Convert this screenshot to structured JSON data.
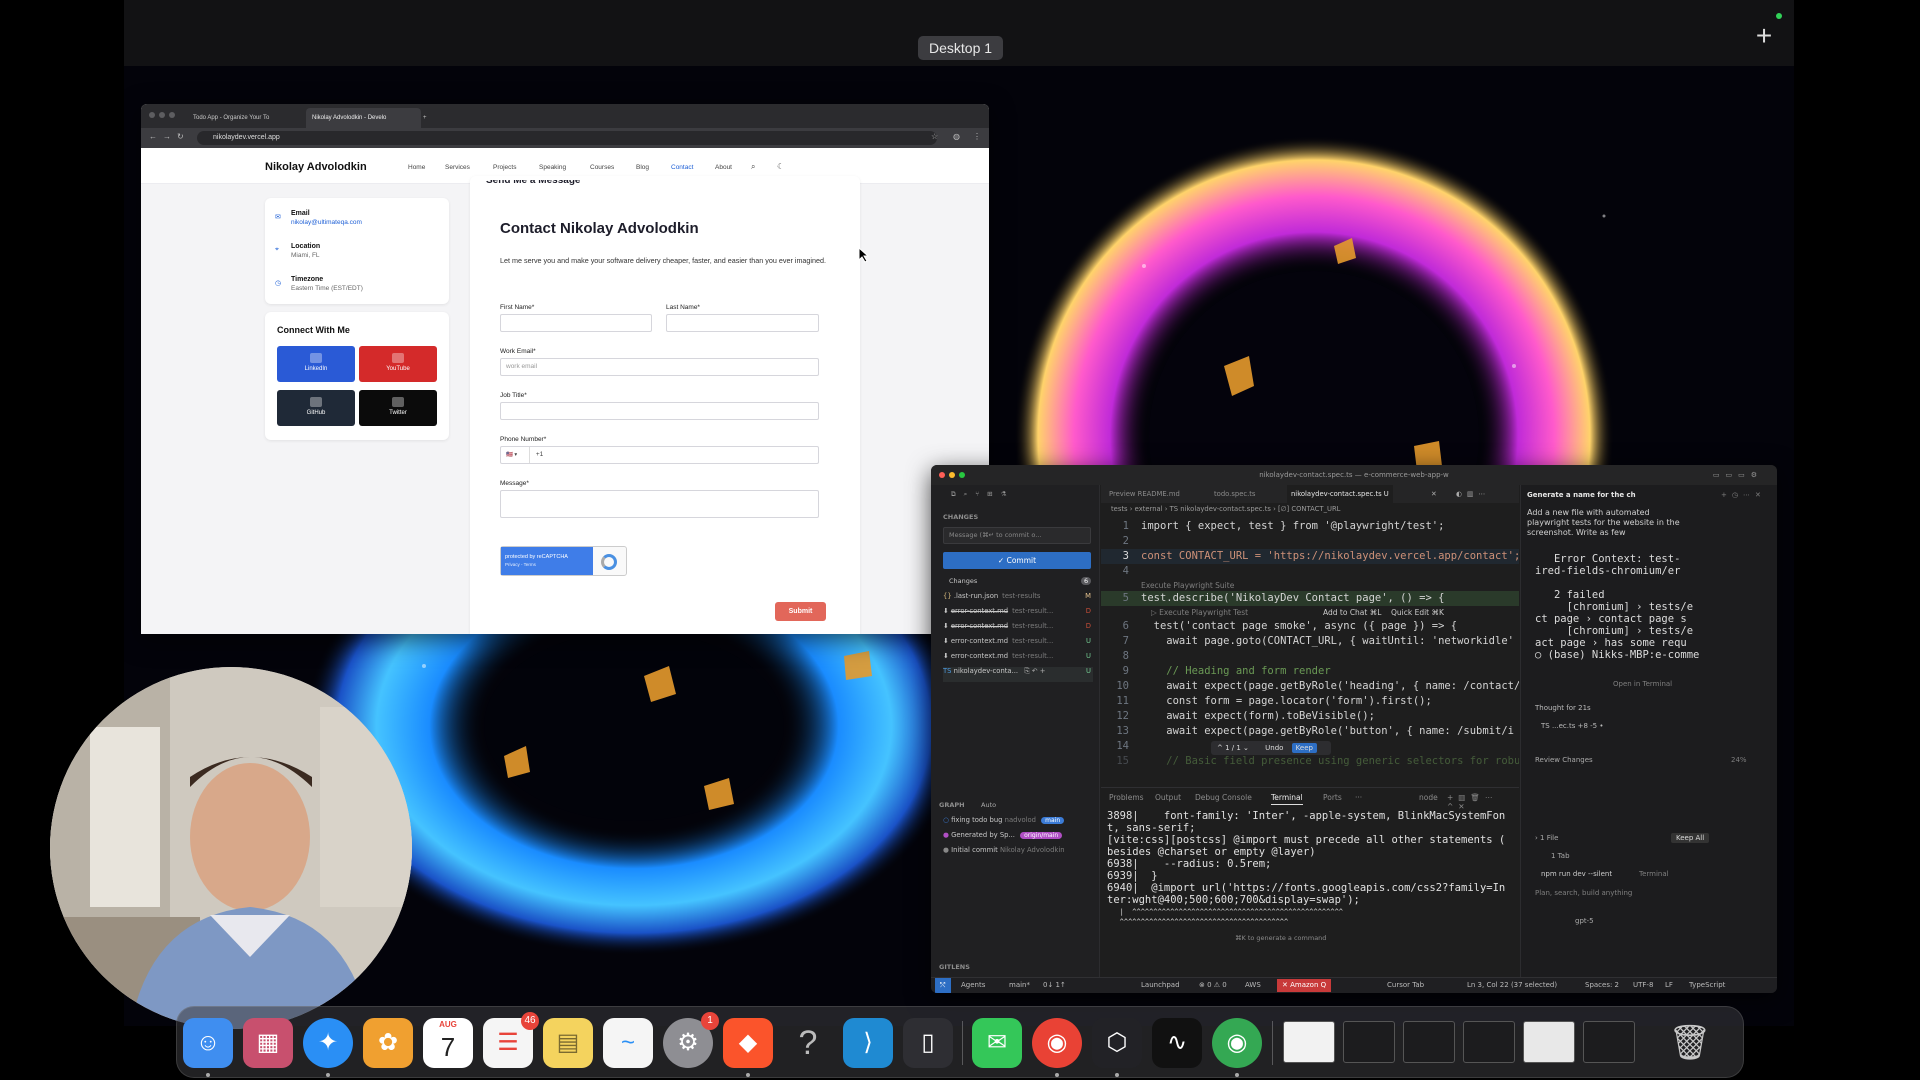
{
  "desktop": {
    "space_label": "Desktop 1",
    "add_space": "+"
  },
  "browser": {
    "tabs": [
      {
        "label": "Todo App - Organize Your To"
      },
      {
        "label": "Nikolay Advolodkin - Develo"
      }
    ],
    "new_tab": "+",
    "url": "nikolaydev.vercel.app",
    "site": {
      "brand": "Nikolay Advolodkin",
      "nav": [
        "Home",
        "Services",
        "Projects",
        "Speaking",
        "Courses",
        "Blog",
        "Contact",
        "About"
      ],
      "active_nav": "Contact",
      "partial_heading": "Send Me a Message",
      "info": [
        {
          "label": "Email",
          "value": "nikolay@ultimateqa.com"
        },
        {
          "label": "Location",
          "value": "Miami, FL"
        },
        {
          "label": "Timezone",
          "value": "Eastern Time (EST/EDT)"
        }
      ],
      "connect_title": "Connect With Me",
      "social": [
        {
          "label": "LinkedIn",
          "color": "#2a5ad6"
        },
        {
          "label": "YouTube",
          "color": "#d42a2a"
        },
        {
          "label": "GitHub",
          "color": "#1f2937"
        },
        {
          "label": "Twitter",
          "color": "#0b0b0b"
        }
      ],
      "form": {
        "title": "Contact Nikolay Advolodkin",
        "description": "Let me serve you and make your software delivery cheaper, faster, and easier than you ever imagined.",
        "first_name_label": "First Name*",
        "last_name_label": "Last Name*",
        "work_email_label": "Work Email*",
        "work_email_placeholder": "work email",
        "job_title_label": "Job Title*",
        "phone_label": "Phone Number*",
        "phone_country": "🇺🇸 ▾",
        "phone_prefix": "+1",
        "message_label": "Message*",
        "recaptcha_text": "protected by reCAPTCHA",
        "recaptcha_sub": "Privacy - Terms",
        "submit_label": "Submit"
      }
    }
  },
  "vscode": {
    "title": "nikolaydev-contact.spec.ts — e-commerce-web-app-w",
    "source_control": {
      "section": "CHANGES",
      "commit_placeholder": "Message (⌘↵ to commit o...",
      "commit_label": "✓ Commit",
      "changes_label": "Changes",
      "changes_count": "6",
      "files": [
        {
          "name": ".last-run.json",
          "path": "test-results",
          "status": "M",
          "strike": false
        },
        {
          "name": "error-context.md",
          "path": "test-result...",
          "status": "D",
          "strike": true
        },
        {
          "name": "error-context.md",
          "path": "test-result...",
          "status": "D",
          "strike": true
        },
        {
          "name": "error-context.md",
          "path": "test-result...",
          "status": "U",
          "strike": false
        },
        {
          "name": "error-context.md",
          "path": "test-result...",
          "status": "U",
          "strike": false
        },
        {
          "name": "nikolaydev-conta...",
          "path": "",
          "status": "U",
          "strike": false
        }
      ],
      "graph_label": "GRAPH",
      "graph_mode": "Auto",
      "commits": [
        {
          "message": "fixing todo bug",
          "author": "nadvolod",
          "badge": "main",
          "badge_color": "#3b7bd6"
        },
        {
          "message": "Generated by Sp...",
          "author": "",
          "badge": "origin/main",
          "badge_color": "#b04fc4"
        },
        {
          "message": "Initial commit",
          "author": "Nikolay Advolodkin",
          "badge": "",
          "badge_color": ""
        }
      ],
      "gitlens": "GITLENS"
    },
    "tabs": [
      "Preview README.md",
      "todo.spec.ts",
      "nikolaydev-contact.spec.ts U"
    ],
    "breadcrumb": "tests › external › TS nikolaydev-contact.spec.ts › [∅] CONTACT_URL",
    "code": [
      {
        "n": "1",
        "text": "import { expect, test } from '@playwright/test';"
      },
      {
        "n": "2",
        "text": ""
      },
      {
        "n": "3",
        "text": "const CONTACT_URL = 'https://nikolaydev.vercel.app/contact';"
      },
      {
        "n": "4",
        "text": ""
      },
      {
        "n": "5",
        "text": "test.describe('NikolayDev Contact page', () => {"
      },
      {
        "n": "6",
        "text": "  test('contact page smoke', async ({ page }) => {"
      },
      {
        "n": "7",
        "text": "    await page.goto(CONTACT_URL, { waitUntil: 'networkidle' }"
      },
      {
        "n": "8",
        "text": ""
      },
      {
        "n": "9",
        "text": "    // Heading and form render"
      },
      {
        "n": "10",
        "text": "    await expect(page.getByRole('heading', { name: /contact/i"
      },
      {
        "n": "11",
        "text": "    const form = page.locator('form').first();"
      },
      {
        "n": "12",
        "text": "    await expect(form).toBeVisible();"
      },
      {
        "n": "13",
        "text": "    await expect(page.getByRole('button', { name: /submit/i })"
      },
      {
        "n": "14",
        "text": ""
      },
      {
        "n": "15",
        "text": "    // Basic field presence using generic selectors for robust"
      }
    ],
    "codelens_suite": "Execute Playwright Suite",
    "codelens_test": "▷ Execute Playwright Test",
    "hint_chat": "Add to Chat ⌘L",
    "hint_edit": "Quick Edit ⌘K",
    "inline_counter": "^ 1 / 1 ⌄",
    "undo_label": "Undo",
    "keep_label": "Keep",
    "panel_tabs": [
      "Problems",
      "Output",
      "Debug Console",
      "Terminal",
      "Ports",
      "···"
    ],
    "terminal_shell": "node",
    "terminal": [
      "3898|    font-family: 'Inter', -apple-system, BlinkMacSystemFon",
      "t, sans-serif;",
      "[vite:css][postcss] @import must precede all other statements (",
      "besides @charset or empty @layer)",
      "6938|    --radius: 0.5rem;",
      "6939|  }",
      "6940|  @import url('https://fonts.googleapis.com/css2?family=In",
      "ter:wght@400;500;600;700&display=swap');",
      "   |  ^^^^^^^^^^^^^^^^^^^^^^^^^^^^^^^^^^^^^^^^^^^^^^^^^^",
      "   ^^^^^^^^^^^^^^^^^^^^^^^^^^^^^^^^^^^^^^^^"
    ],
    "terminal_hint": "⌘K to generate a command",
    "chat": {
      "title": "Generate a name for the ch",
      "prompt": "Add a new file with automated playwright tests for the website in the screenshot. Write as few",
      "error_lines": [
        "   Error Context: test-",
        "ired-fields-chromium/er",
        "",
        "   2 failed",
        "     [chromium] › tests/e",
        "ct page › contact page s",
        "     [chromium] › tests/e",
        "act page › has some requ",
        "○ (base) Nikks-MBP:e-comme"
      ],
      "open_terminal": "Open in Terminal",
      "thought": "Thought for 21s",
      "file_change": "TS ...ec.ts +8 -5 •",
      "review_changes": "Review Changes",
      "review_pct": "24%",
      "files_count": "› 1 File",
      "keep_all": "Keep All",
      "tab_count": "1 Tab",
      "npm_cmd": "npm run dev --silent",
      "npm_where": "Terminal",
      "plan_placeholder": "Plan, search, build anything",
      "model": "gpt-5"
    },
    "status": {
      "agents": "Agents",
      "branch": "main*",
      "sync": "0↓ 1↑",
      "launchpad": "Launchpad",
      "problems": "⊗ 0 ⚠ 0",
      "aws": "AWS",
      "amazon_q": "✕ Amazon Q",
      "cursor_tab": "Cursor Tab",
      "position": "Ln 3, Col 22 (37 selected)",
      "spaces": "Spaces: 2",
      "encoding": "UTF-8",
      "eol": "LF",
      "language": "TypeScript"
    }
  },
  "dock": {
    "apps": [
      {
        "name": "finder-icon",
        "glyph": "☺",
        "color": "#3f8ef0",
        "badge": ""
      },
      {
        "name": "launchpad-icon",
        "glyph": "▦",
        "color": "#c8506e",
        "badge": ""
      },
      {
        "name": "safari-icon",
        "glyph": "✦",
        "color": "#2a8ff5",
        "badge": ""
      },
      {
        "name": "photos-icon",
        "glyph": "✿",
        "color": "#f0a030",
        "badge": ""
      },
      {
        "name": "calendar-icon",
        "glyph": "7",
        "color": "#ffffff",
        "badge": ""
      },
      {
        "name": "reminders-icon",
        "glyph": "☰",
        "color": "#f5f5f5",
        "badge": "46"
      },
      {
        "name": "notes-icon",
        "glyph": "▤",
        "color": "#f4d35e",
        "badge": ""
      },
      {
        "name": "freeform-icon",
        "glyph": "~",
        "color": "#f5f5f5",
        "badge": ""
      },
      {
        "name": "system-settings-icon",
        "glyph": "⚙",
        "color": "#8e8e93",
        "badge": "1"
      },
      {
        "name": "brave-icon",
        "glyph": "◆",
        "color": "#fb542b",
        "badge": ""
      },
      {
        "name": "help-icon",
        "glyph": "?",
        "color": "transparent",
        "badge": ""
      },
      {
        "name": "vscode-icon",
        "glyph": "⟩",
        "color": "#1f8ad2",
        "badge": ""
      },
      {
        "name": "simulator-icon",
        "glyph": "▯",
        "color": "#2e2e33",
        "badge": ""
      },
      {
        "name": "messages-icon",
        "glyph": "✉",
        "color": "#34c759",
        "badge": ""
      },
      {
        "name": "chrome-icon",
        "glyph": "◉",
        "color": "#e94235",
        "badge": ""
      },
      {
        "name": "cursor-app-icon",
        "glyph": "⬡",
        "color": "#222226",
        "badge": ""
      },
      {
        "name": "warp-icon",
        "glyph": "∿",
        "color": "#111111",
        "badge": ""
      },
      {
        "name": "chrome-2-icon",
        "glyph": "◉",
        "color": "#34a853",
        "badge": ""
      }
    ],
    "calendar_month": "AUG",
    "calendar_day": "7"
  }
}
